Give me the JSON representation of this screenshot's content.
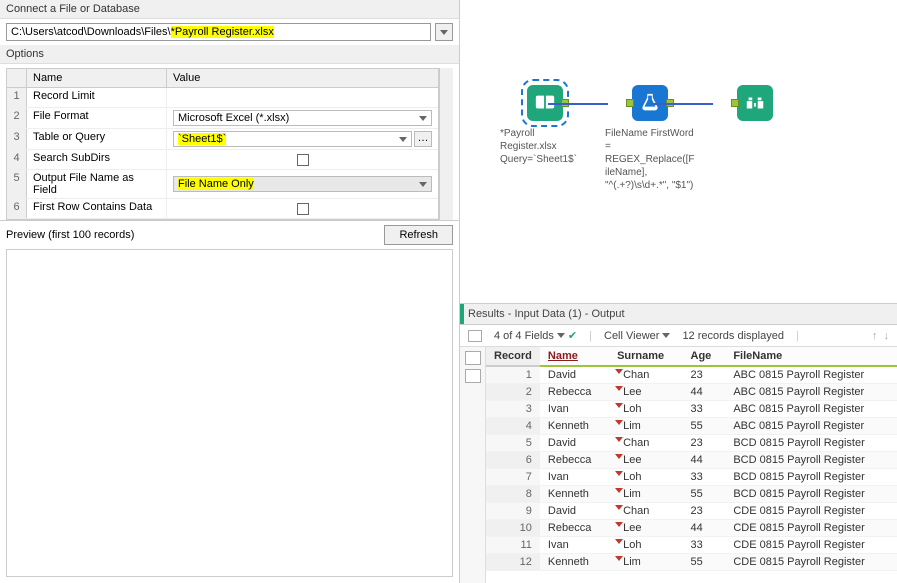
{
  "leftPane": {
    "connectTitle": "Connect a File or Database",
    "pathPrefix": "C:\\Users\\atcod\\Downloads\\Files\\",
    "pathHighlighted": "*Payroll Register.xlsx",
    "optionsTitle": "Options",
    "headerName": "Name",
    "headerValue": "Value",
    "rows": [
      {
        "n": "1",
        "name": "Record Limit",
        "value": ""
      },
      {
        "n": "2",
        "name": "File Format",
        "value": "Microsoft Excel (*.xlsx)"
      },
      {
        "n": "3",
        "name": "Table or Query",
        "valueHl": "`Sheet1$`"
      },
      {
        "n": "4",
        "name": "Search SubDirs",
        "checkbox": true
      },
      {
        "n": "5",
        "name": "Output File Name as Field",
        "valueHl": "File Name Only"
      },
      {
        "n": "6",
        "name": "First Row Contains Data",
        "checkbox": true
      }
    ],
    "previewTitle": "Preview (first 100 records)",
    "refreshLabel": "Refresh"
  },
  "canvas": {
    "node1": "*Payroll Register.xlsx Query=`Sheet1$`",
    "node2": "FileName FirstWord = REGEX_Replace([FileName], \"^(.+?)\\s\\d+.*\", \"$1\")"
  },
  "results": {
    "title": "Results - Input Data (1) - Output",
    "fieldsLabel": "4 of 4 Fields",
    "cellViewerLabel": "Cell Viewer",
    "recordsLabel": "12 records displayed",
    "columns": [
      "Record",
      "Name",
      "Surname",
      "Age",
      "FileName"
    ],
    "rows": [
      {
        "r": "1",
        "name": "David",
        "surname": "Chan",
        "age": "23",
        "file": "ABC 0815 Payroll Register"
      },
      {
        "r": "2",
        "name": "Rebecca",
        "surname": "Lee",
        "age": "44",
        "file": "ABC 0815 Payroll Register"
      },
      {
        "r": "3",
        "name": "Ivan",
        "surname": "Loh",
        "age": "33",
        "file": "ABC 0815 Payroll Register"
      },
      {
        "r": "4",
        "name": "Kenneth",
        "surname": "Lim",
        "age": "55",
        "file": "ABC 0815 Payroll Register"
      },
      {
        "r": "5",
        "name": "David",
        "surname": "Chan",
        "age": "23",
        "file": "BCD 0815 Payroll Register"
      },
      {
        "r": "6",
        "name": "Rebecca",
        "surname": "Lee",
        "age": "44",
        "file": "BCD 0815 Payroll Register"
      },
      {
        "r": "7",
        "name": "Ivan",
        "surname": "Loh",
        "age": "33",
        "file": "BCD 0815 Payroll Register"
      },
      {
        "r": "8",
        "name": "Kenneth",
        "surname": "Lim",
        "age": "55",
        "file": "BCD 0815 Payroll Register"
      },
      {
        "r": "9",
        "name": "David",
        "surname": "Chan",
        "age": "23",
        "file": "CDE 0815 Payroll Register"
      },
      {
        "r": "10",
        "name": "Rebecca",
        "surname": "Lee",
        "age": "44",
        "file": "CDE 0815 Payroll Register"
      },
      {
        "r": "11",
        "name": "Ivan",
        "surname": "Loh",
        "age": "33",
        "file": "CDE 0815 Payroll Register"
      },
      {
        "r": "12",
        "name": "Kenneth",
        "surname": "Lim",
        "age": "55",
        "file": "CDE 0815 Payroll Register"
      }
    ]
  }
}
